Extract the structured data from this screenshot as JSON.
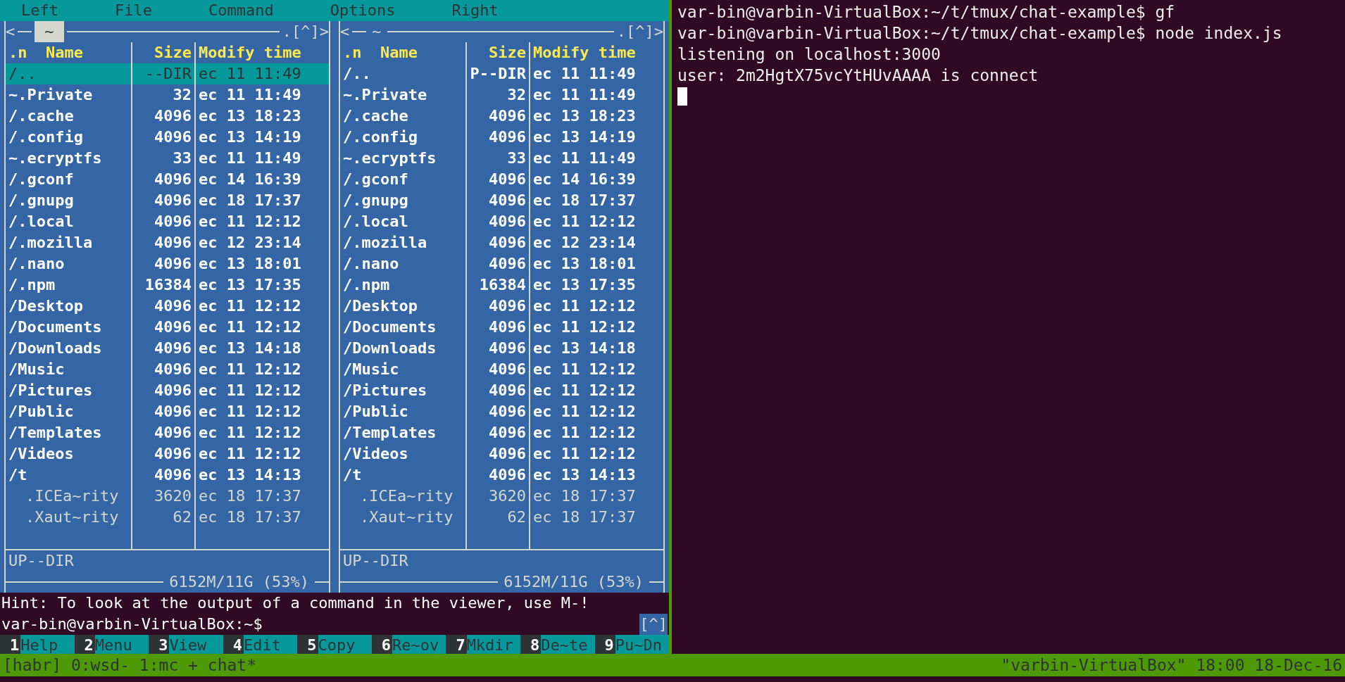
{
  "menu_bar": [
    "Left",
    "File",
    "Command",
    "Options",
    "Right"
  ],
  "panels": [
    {
      "nav_left": "<",
      "path": "~",
      "active": true,
      "nav_right": ".[^]>",
      "columns": [
        ".n  Name",
        "Size",
        "Modify time"
      ],
      "files": [
        {
          "name": "/..",
          "size": "--DIR",
          "time": "ec 11 11:49",
          "kind": "dir",
          "selected": true
        },
        {
          "name": "~.Private",
          "size": "32",
          "time": "ec 11 11:49",
          "kind": "dir",
          "selected": false
        },
        {
          "name": "/.cache",
          "size": "4096",
          "time": "ec 13 18:23",
          "kind": "dir",
          "selected": false
        },
        {
          "name": "/.config",
          "size": "4096",
          "time": "ec 13 14:19",
          "kind": "dir",
          "selected": false
        },
        {
          "name": "~.ecryptfs",
          "size": "33",
          "time": "ec 11 11:49",
          "kind": "dir",
          "selected": false
        },
        {
          "name": "/.gconf",
          "size": "4096",
          "time": "ec 14 16:39",
          "kind": "dir",
          "selected": false
        },
        {
          "name": "/.gnupg",
          "size": "4096",
          "time": "ec 18 17:37",
          "kind": "dir",
          "selected": false
        },
        {
          "name": "/.local",
          "size": "4096",
          "time": "ec 11 12:12",
          "kind": "dir",
          "selected": false
        },
        {
          "name": "/.mozilla",
          "size": "4096",
          "time": "ec 12 23:14",
          "kind": "dir",
          "selected": false
        },
        {
          "name": "/.nano",
          "size": "4096",
          "time": "ec 13 18:01",
          "kind": "dir",
          "selected": false
        },
        {
          "name": "/.npm",
          "size": "16384",
          "time": "ec 13 17:35",
          "kind": "dir",
          "selected": false
        },
        {
          "name": "/Desktop",
          "size": "4096",
          "time": "ec 11 12:12",
          "kind": "dir",
          "selected": false
        },
        {
          "name": "/Documents",
          "size": "4096",
          "time": "ec 11 12:12",
          "kind": "dir",
          "selected": false
        },
        {
          "name": "/Downloads",
          "size": "4096",
          "time": "ec 13 14:18",
          "kind": "dir",
          "selected": false
        },
        {
          "name": "/Music",
          "size": "4096",
          "time": "ec 11 12:12",
          "kind": "dir",
          "selected": false
        },
        {
          "name": "/Pictures",
          "size": "4096",
          "time": "ec 11 12:12",
          "kind": "dir",
          "selected": false
        },
        {
          "name": "/Public",
          "size": "4096",
          "time": "ec 11 12:12",
          "kind": "dir",
          "selected": false
        },
        {
          "name": "/Templates",
          "size": "4096",
          "time": "ec 11 12:12",
          "kind": "dir",
          "selected": false
        },
        {
          "name": "/Videos",
          "size": "4096",
          "time": "ec 11 12:12",
          "kind": "dir",
          "selected": false
        },
        {
          "name": "/t",
          "size": "4096",
          "time": "ec 13 14:13",
          "kind": "dir",
          "selected": false
        },
        {
          "name": ".ICEa~rity",
          "size": "3620",
          "time": "ec 18 17:37",
          "kind": "file",
          "selected": false
        },
        {
          "name": ".Xaut~rity",
          "size": "62",
          "time": "ec 18 17:37",
          "kind": "file",
          "selected": false
        }
      ],
      "mini_status": "UP--DIR",
      "disk": "6152M/11G (53%)"
    },
    {
      "nav_left": "<",
      "path": "~",
      "active": false,
      "nav_right": ".[^]>",
      "columns": [
        ".n  Name",
        "Size",
        "Modify time"
      ],
      "files": [
        {
          "name": "/..",
          "size": "P--DIR",
          "time": "ec 11 11:49",
          "kind": "dir",
          "selected": false
        },
        {
          "name": "~.Private",
          "size": "32",
          "time": "ec 11 11:49",
          "kind": "dir",
          "selected": false
        },
        {
          "name": "/.cache",
          "size": "4096",
          "time": "ec 13 18:23",
          "kind": "dir",
          "selected": false
        },
        {
          "name": "/.config",
          "size": "4096",
          "time": "ec 13 14:19",
          "kind": "dir",
          "selected": false
        },
        {
          "name": "~.ecryptfs",
          "size": "33",
          "time": "ec 11 11:49",
          "kind": "dir",
          "selected": false
        },
        {
          "name": "/.gconf",
          "size": "4096",
          "time": "ec 14 16:39",
          "kind": "dir",
          "selected": false
        },
        {
          "name": "/.gnupg",
          "size": "4096",
          "time": "ec 18 17:37",
          "kind": "dir",
          "selected": false
        },
        {
          "name": "/.local",
          "size": "4096",
          "time": "ec 11 12:12",
          "kind": "dir",
          "selected": false
        },
        {
          "name": "/.mozilla",
          "size": "4096",
          "time": "ec 12 23:14",
          "kind": "dir",
          "selected": false
        },
        {
          "name": "/.nano",
          "size": "4096",
          "time": "ec 13 18:01",
          "kind": "dir",
          "selected": false
        },
        {
          "name": "/.npm",
          "size": "16384",
          "time": "ec 13 17:35",
          "kind": "dir",
          "selected": false
        },
        {
          "name": "/Desktop",
          "size": "4096",
          "time": "ec 11 12:12",
          "kind": "dir",
          "selected": false
        },
        {
          "name": "/Documents",
          "size": "4096",
          "time": "ec 11 12:12",
          "kind": "dir",
          "selected": false
        },
        {
          "name": "/Downloads",
          "size": "4096",
          "time": "ec 13 14:18",
          "kind": "dir",
          "selected": false
        },
        {
          "name": "/Music",
          "size": "4096",
          "time": "ec 11 12:12",
          "kind": "dir",
          "selected": false
        },
        {
          "name": "/Pictures",
          "size": "4096",
          "time": "ec 11 12:12",
          "kind": "dir",
          "selected": false
        },
        {
          "name": "/Public",
          "size": "4096",
          "time": "ec 11 12:12",
          "kind": "dir",
          "selected": false
        },
        {
          "name": "/Templates",
          "size": "4096",
          "time": "ec 11 12:12",
          "kind": "dir",
          "selected": false
        },
        {
          "name": "/Videos",
          "size": "4096",
          "time": "ec 11 12:12",
          "kind": "dir",
          "selected": false
        },
        {
          "name": "/t",
          "size": "4096",
          "time": "ec 13 14:13",
          "kind": "dir",
          "selected": false
        },
        {
          "name": ".ICEa~rity",
          "size": "3620",
          "time": "ec 18 17:37",
          "kind": "file",
          "selected": false
        },
        {
          "name": ".Xaut~rity",
          "size": "62",
          "time": "ec 18 17:37",
          "kind": "file",
          "selected": false
        }
      ],
      "mini_status": "UP--DIR",
      "disk": "6152M/11G (53%)"
    }
  ],
  "hint": "Hint: To look at the output of a command in the viewer, use M-!",
  "prompt": "var-bin@varbin-VirtualBox:~$",
  "prompt_button": "[^]",
  "function_keys": [
    {
      "num": "1",
      "label": "Help"
    },
    {
      "num": "2",
      "label": "Menu"
    },
    {
      "num": "3",
      "label": "View"
    },
    {
      "num": "4",
      "label": "Edit"
    },
    {
      "num": "5",
      "label": "Copy"
    },
    {
      "num": "6",
      "label": "Re~ov"
    },
    {
      "num": "7",
      "label": "Mkdir"
    },
    {
      "num": "8",
      "label": "De~te"
    },
    {
      "num": "9",
      "label": "Pu~Dn"
    }
  ],
  "terminal_lines": [
    "var-bin@varbin-VirtualBox:~/t/tmux/chat-example$ gf",
    "var-bin@varbin-VirtualBox:~/t/tmux/chat-example$ node index.js",
    "listening on localhost:3000",
    "user: 2m2HgtX75vcYtHUvAAAA is connect"
  ],
  "status_bar": {
    "left": "[habr] 0:wsd- 1:mc + chat*",
    "right": "\"varbin-VirtualBox\" 18:00 18-Dec-16"
  }
}
